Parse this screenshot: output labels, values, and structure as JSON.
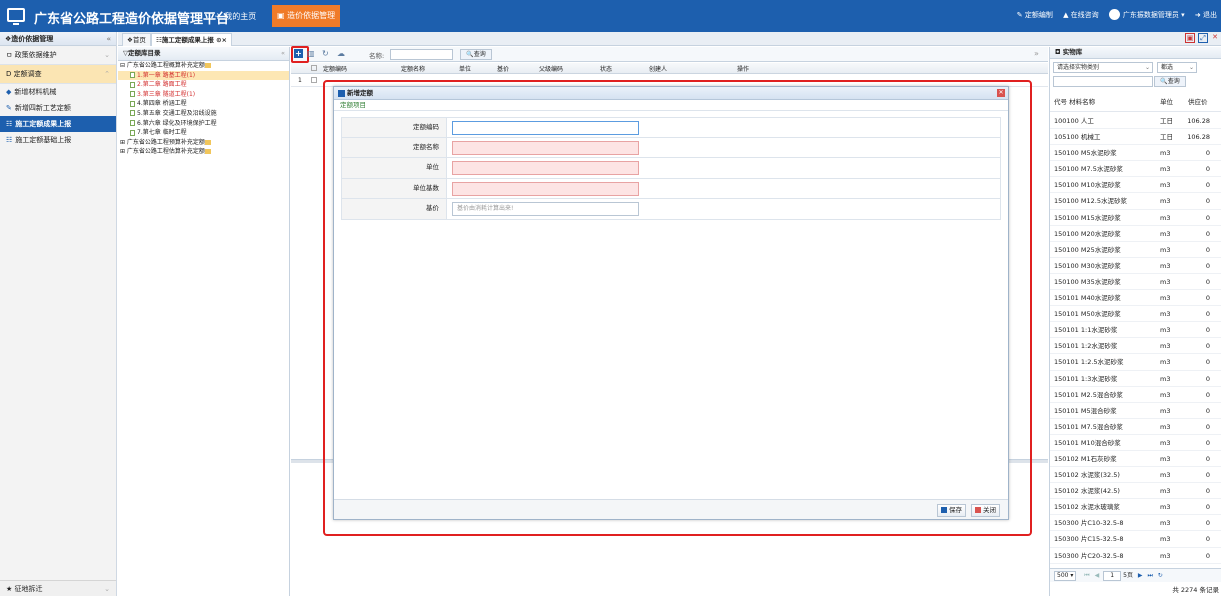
{
  "topbar": {
    "title": "广东省公路工程造价依据管理平台",
    "home": "✈ 我的主页",
    "active": "▣ 造价依据管理",
    "right_items": [
      "✎ 定额编制",
      "▲ 在线咨询",
      "广东振数据管理员 ▾",
      "➜ 退出"
    ]
  },
  "sidebar": {
    "header": "❖造价依据管理",
    "groups": [
      {
        "label": "ㅁ 政策依据维护",
        "open": false
      },
      {
        "label": "D 定额调查",
        "open": true
      }
    ],
    "items": [
      {
        "icon": "◆",
        "label": "新增材料机械"
      },
      {
        "icon": "✎",
        "label": "新增四新工艺定额"
      },
      {
        "icon": "☷",
        "label": "施工定额成果上报"
      },
      {
        "icon": "☷",
        "label": "施工定额基础上报"
      }
    ],
    "bottom": "★ 征地拆迁"
  },
  "tabs": [
    "❖首页",
    "☷施工定额成果上报 ⊙×"
  ],
  "tree": {
    "header": "▽定额库目录",
    "nodes": [
      {
        "label": "⊟ 广东省公路工程概算补充定额",
        "type": "folder",
        "level": 0,
        "red": false,
        "sel": false
      },
      {
        "label": "1.第一章 路基工程(1)",
        "type": "leaf",
        "level": 1,
        "red": true,
        "sel": true
      },
      {
        "label": "2.第二章 路面工程",
        "type": "leaf",
        "level": 1,
        "red": true,
        "sel": false
      },
      {
        "label": "3.第三章 隧道工程(1)",
        "type": "leaf",
        "level": 1,
        "red": true,
        "sel": false
      },
      {
        "label": "4.第四章 桥涵工程",
        "type": "leaf",
        "level": 1,
        "red": false,
        "sel": false
      },
      {
        "label": "5.第五章 交通工程及沿线设施",
        "type": "leaf",
        "level": 1,
        "red": false,
        "sel": false
      },
      {
        "label": "6.第六章 绿化及环境保护工程",
        "type": "leaf",
        "level": 1,
        "red": false,
        "sel": false
      },
      {
        "label": "7.第七章 临时工程",
        "type": "leaf",
        "level": 1,
        "red": false,
        "sel": false
      },
      {
        "label": "⊞ 广东省公路工程预算补充定额",
        "type": "folder",
        "level": 0,
        "red": false,
        "sel": false
      },
      {
        "label": "⊞ 广东省公路工程估算补充定额",
        "type": "folder",
        "level": 0,
        "red": false,
        "sel": false
      }
    ]
  },
  "grid": {
    "name_label": "名称:",
    "query_btn": "🔍查询",
    "columns": [
      "定额编码",
      "定额名称",
      "单位",
      "基价",
      "父级编码",
      "状态",
      "创建人",
      "操作"
    ],
    "row_num": "1"
  },
  "dialog": {
    "title": "新增定额",
    "section": "定额项目",
    "fields": [
      {
        "label": "定额编码",
        "placeholder": "",
        "style": "focus"
      },
      {
        "label": "定额名称",
        "placeholder": "",
        "style": "req"
      },
      {
        "label": "单位",
        "placeholder": "",
        "style": "req"
      },
      {
        "label": "单位基数",
        "placeholder": "",
        "style": "req"
      },
      {
        "label": "基价",
        "placeholder": "基价由消耗计算出来!",
        "style": "plain"
      }
    ],
    "save": "保存",
    "close": "关闭"
  },
  "rpanel": {
    "header": "◘ 实物库",
    "select1": "请选择实物类别",
    "select2": "都选",
    "query_btn": "🔍查询",
    "col_code_name": "代号  材料名称",
    "col_unit": "单位",
    "col_price": "供应价",
    "rows": [
      {
        "code": "100100 人工",
        "unit": "工日",
        "price": "106.28"
      },
      {
        "code": "105100 机械工",
        "unit": "工日",
        "price": "106.28"
      },
      {
        "code": "150100 M5水泥砂浆",
        "unit": "m3",
        "price": "0"
      },
      {
        "code": "150100 M7.5水泥砂浆",
        "unit": "m3",
        "price": "0"
      },
      {
        "code": "150100 M10水泥砂浆",
        "unit": "m3",
        "price": "0"
      },
      {
        "code": "150100 M12.5水泥砂浆",
        "unit": "m3",
        "price": "0"
      },
      {
        "code": "150100 M15水泥砂浆",
        "unit": "m3",
        "price": "0"
      },
      {
        "code": "150100 M20水泥砂浆",
        "unit": "m3",
        "price": "0"
      },
      {
        "code": "150100 M25水泥砂浆",
        "unit": "m3",
        "price": "0"
      },
      {
        "code": "150100 M30水泥砂浆",
        "unit": "m3",
        "price": "0"
      },
      {
        "code": "150100 M35水泥砂浆",
        "unit": "m3",
        "price": "0"
      },
      {
        "code": "150101 M40水泥砂浆",
        "unit": "m3",
        "price": "0"
      },
      {
        "code": "150101 M50水泥砂浆",
        "unit": "m3",
        "price": "0"
      },
      {
        "code": "150101 1:1水泥砂浆",
        "unit": "m3",
        "price": "0"
      },
      {
        "code": "150101 1:2水泥砂浆",
        "unit": "m3",
        "price": "0"
      },
      {
        "code": "150101 1:2.5水泥砂浆",
        "unit": "m3",
        "price": "0"
      },
      {
        "code": "150101 1:3水泥砂浆",
        "unit": "m3",
        "price": "0"
      },
      {
        "code": "150101 M2.5混合砂浆",
        "unit": "m3",
        "price": "0"
      },
      {
        "code": "150101 M5混合砂浆",
        "unit": "m3",
        "price": "0"
      },
      {
        "code": "150101 M7.5混合砂浆",
        "unit": "m3",
        "price": "0"
      },
      {
        "code": "150101 M10混合砂浆",
        "unit": "m3",
        "price": "0"
      },
      {
        "code": "150102 M1石灰砂浆",
        "unit": "m3",
        "price": "0"
      },
      {
        "code": "150102 水泥浆(32.5)",
        "unit": "m3",
        "price": "0"
      },
      {
        "code": "150102 水泥浆(42.5)",
        "unit": "m3",
        "price": "0"
      },
      {
        "code": "150102 水泥水玻璃浆",
        "unit": "m3",
        "price": "0"
      },
      {
        "code": "150300 片C10-32.5-8",
        "unit": "m3",
        "price": "0"
      },
      {
        "code": "150300 片C15-32.5-8",
        "unit": "m3",
        "price": "0"
      },
      {
        "code": "150300 片C20-32.5-8",
        "unit": "m3",
        "price": "0"
      }
    ],
    "page_size": "500",
    "page": "1",
    "page_total": "5页",
    "total": "共 2274 条记录"
  }
}
